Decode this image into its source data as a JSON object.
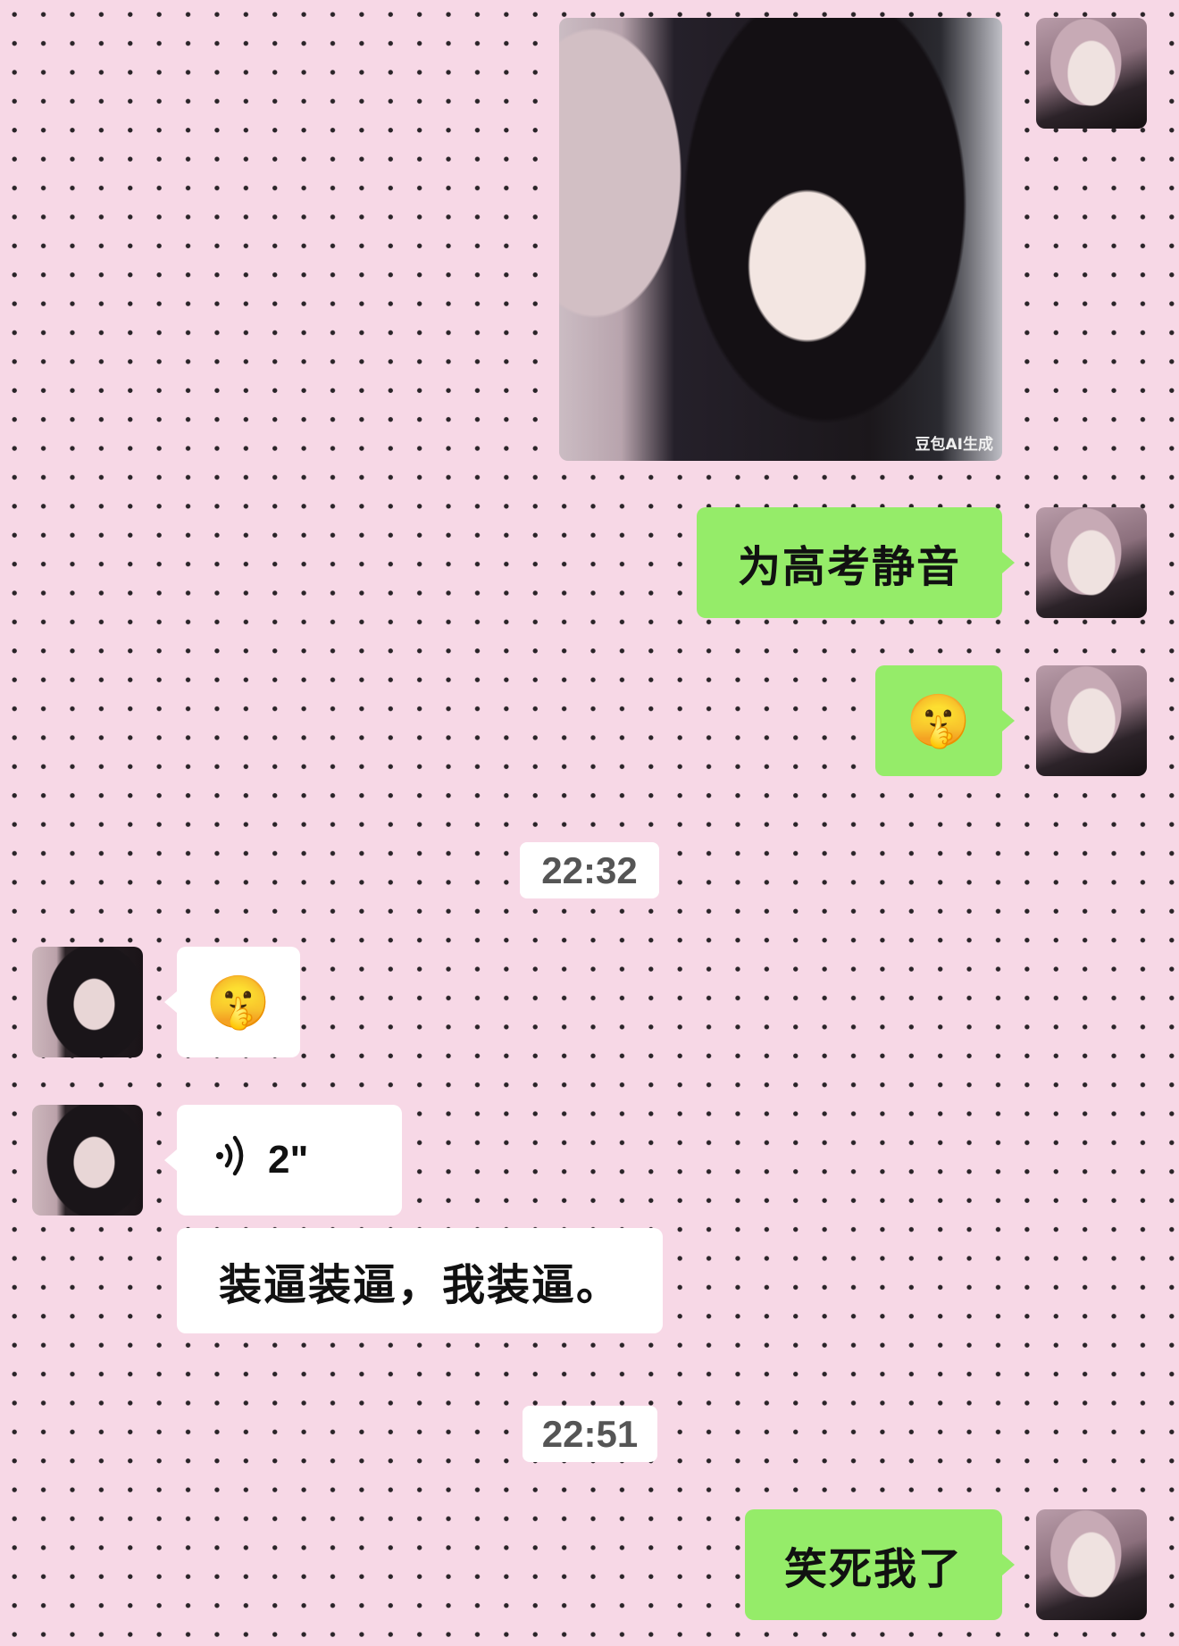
{
  "messages": {
    "image_watermark": "豆包AI生成",
    "text_1": "为高考静音",
    "emoji_1": "🤫",
    "timestamp_1": "22:32",
    "emoji_2": "🤫",
    "voice_icon": "voice-wave-icon",
    "voice_duration": "2\"",
    "transcription": "装逼装逼，我装逼。",
    "timestamp_2": "22:51",
    "text_2": "笑死我了"
  },
  "colors": {
    "background": "#f7d8e6",
    "sent_bubble": "#95ec69",
    "received_bubble": "#ffffff"
  }
}
